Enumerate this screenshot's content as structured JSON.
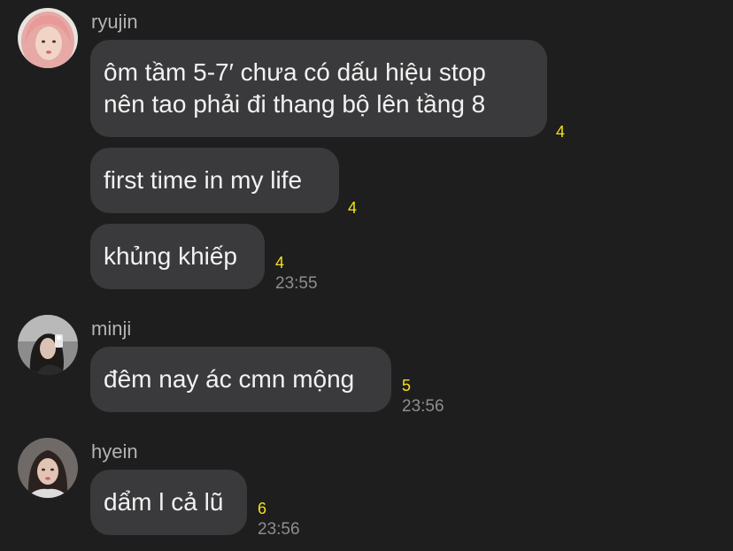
{
  "messages": [
    {
      "sender": "ryujin",
      "avatar": "profile-photo-blonde",
      "bubbles": [
        {
          "lines": [
            "ôm tầm 5-7′ chưa có dấu hiệu stop",
            "nên tao phải đi thang bộ lên tầng 8"
          ],
          "unread": "4"
        },
        {
          "lines": [
            "first time in my life"
          ],
          "unread": "4"
        },
        {
          "lines": [
            "khủng khiếp"
          ],
          "unread": "4",
          "time": "23:55"
        }
      ]
    },
    {
      "sender": "minji",
      "avatar": "profile-photo-mirror-selfie",
      "bubbles": [
        {
          "lines": [
            "đêm nay ác cmn mộng"
          ],
          "unread": "5",
          "time": "23:56"
        }
      ]
    },
    {
      "sender": "hyein",
      "avatar": "profile-photo-portrait",
      "bubbles": [
        {
          "lines": [
            "dẩm l cả lũ"
          ],
          "unread": "6",
          "time": "23:56"
        }
      ]
    }
  ],
  "colors": {
    "background": "#1e1e1e",
    "bubble": "#3a3a3c",
    "unread": "#f5e11a",
    "timestamp": "#8e8e8e"
  }
}
